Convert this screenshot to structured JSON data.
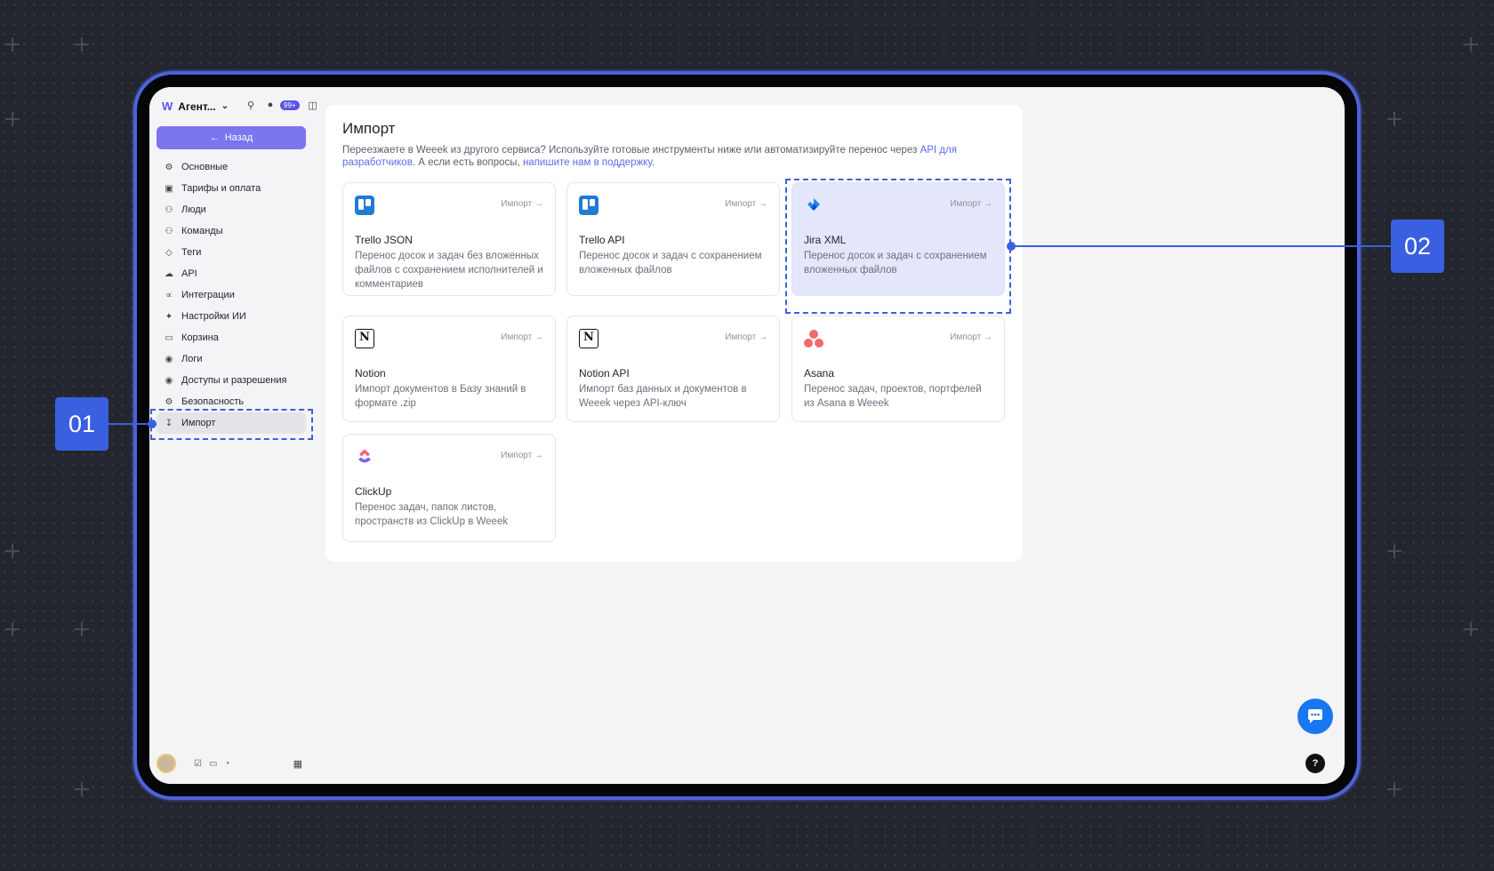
{
  "workspace": {
    "name": "Агент...",
    "notif_badge": "99+"
  },
  "sidebar": {
    "back_label": "Назад",
    "items": [
      {
        "label": "Основные",
        "icon": "gear-icon"
      },
      {
        "label": "Тарифы и оплата",
        "icon": "credit-card-icon"
      },
      {
        "label": "Люди",
        "icon": "people-icon"
      },
      {
        "label": "Команды",
        "icon": "teams-icon"
      },
      {
        "label": "Теги",
        "icon": "tag-icon"
      },
      {
        "label": "API",
        "icon": "cloud-icon"
      },
      {
        "label": "Интеграции",
        "icon": "integrations-icon"
      },
      {
        "label": "Настройки ИИ",
        "icon": "sparkles-icon"
      },
      {
        "label": "Корзина",
        "icon": "trash-icon"
      },
      {
        "label": "Логи",
        "icon": "lock-icon"
      },
      {
        "label": "Доступы и разрешения",
        "icon": "shield-lock-icon"
      },
      {
        "label": "Безопасность",
        "icon": "security-gear-icon"
      },
      {
        "label": "Импорт",
        "icon": "download-icon",
        "active": true
      }
    ]
  },
  "main": {
    "title": "Импорт",
    "desc_part1": "Переезжаете в Weeek из другого сервиса? Используйте готовые инструменты ниже или автоматизируйте перенос через ",
    "desc_link1": "API для разработчиков",
    "desc_part2": ". А если есть вопросы, ",
    "desc_link2": "напишите нам в поддержку",
    "desc_part3": ".",
    "import_label": "Импорт",
    "cards": [
      {
        "name": "Trello JSON",
        "desc": "Перенос досок и задач без вложенных файлов с сохранением исполнителей и комментариев",
        "logo": "trello-icon"
      },
      {
        "name": "Trello API",
        "desc": "Перенос досок и задач с сохранением вложенных файлов",
        "logo": "trello-icon"
      },
      {
        "name": "Jira XML",
        "desc": "Перенос досок и задач с сохранением вложенных файлов",
        "logo": "jira-icon"
      },
      {
        "name": "Notion",
        "desc": "Импорт документов в Базу знаний в формате .zip",
        "logo": "notion-icon"
      },
      {
        "name": "Notion API",
        "desc": "Импорт баз данных и документов в Weeek через API-ключ",
        "logo": "notion-icon"
      },
      {
        "name": "Asana",
        "desc": "Перенос задач, проектов, портфелей из Asana в Weeek",
        "logo": "asana-icon"
      },
      {
        "name": "ClickUp",
        "desc": "Перенос задач, папок листов, пространств из ClickUp в Weeek",
        "logo": "clickup-icon"
      }
    ]
  },
  "callouts": {
    "c1": "01",
    "c2": "02"
  },
  "colors": {
    "accent": "#3a5fe0",
    "button": "#7b75ee",
    "selected_card": "#e4e7fb"
  }
}
